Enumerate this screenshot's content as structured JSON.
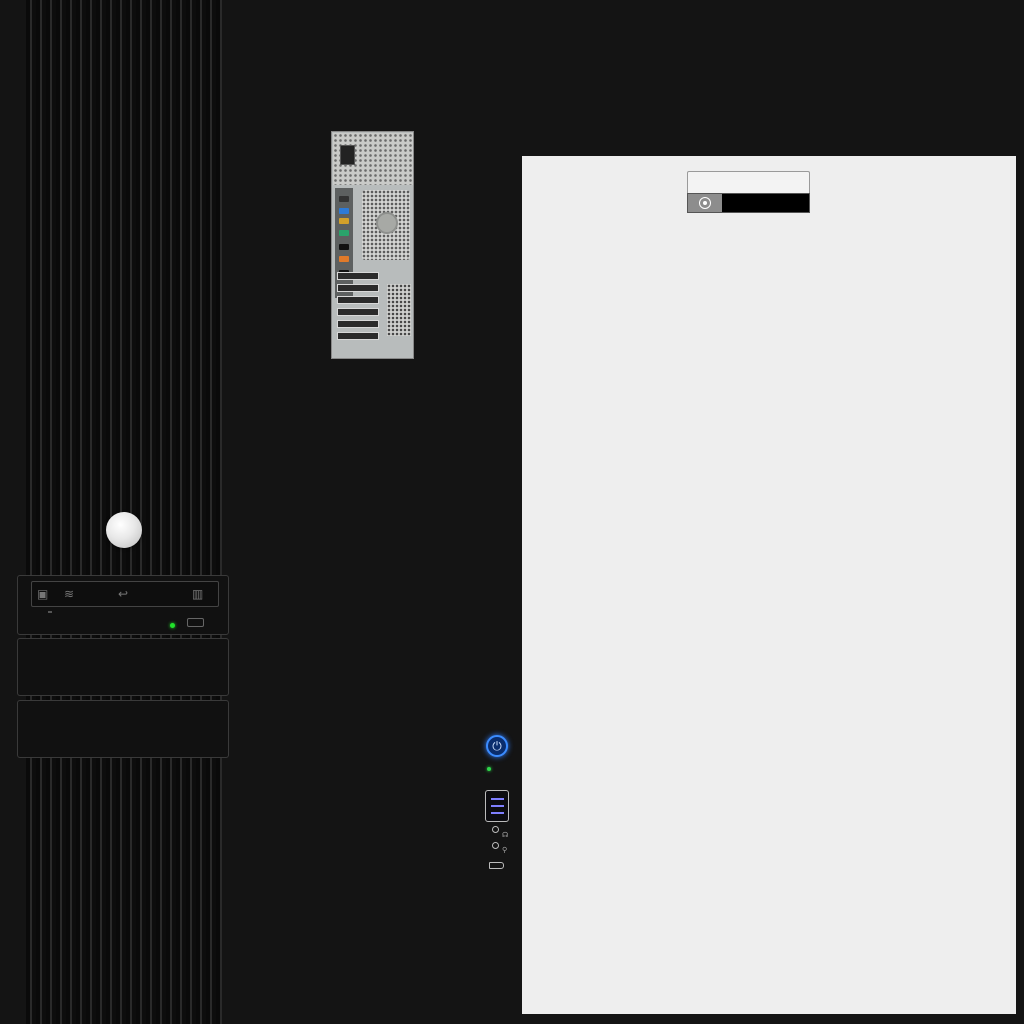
{
  "front_panel": {
    "drive": {
      "tray_icons": [
        "▣",
        "≋",
        "↩",
        "▥"
      ]
    }
  },
  "front_io": {
    "power_symbol": "⏻",
    "headphone_glyph": "☊",
    "mic_glyph": "⚲"
  },
  "colors": {
    "background": "#141414",
    "panel": "#eeeeee",
    "power_blue": "#3b8cff",
    "led_green": "#21e32b"
  }
}
